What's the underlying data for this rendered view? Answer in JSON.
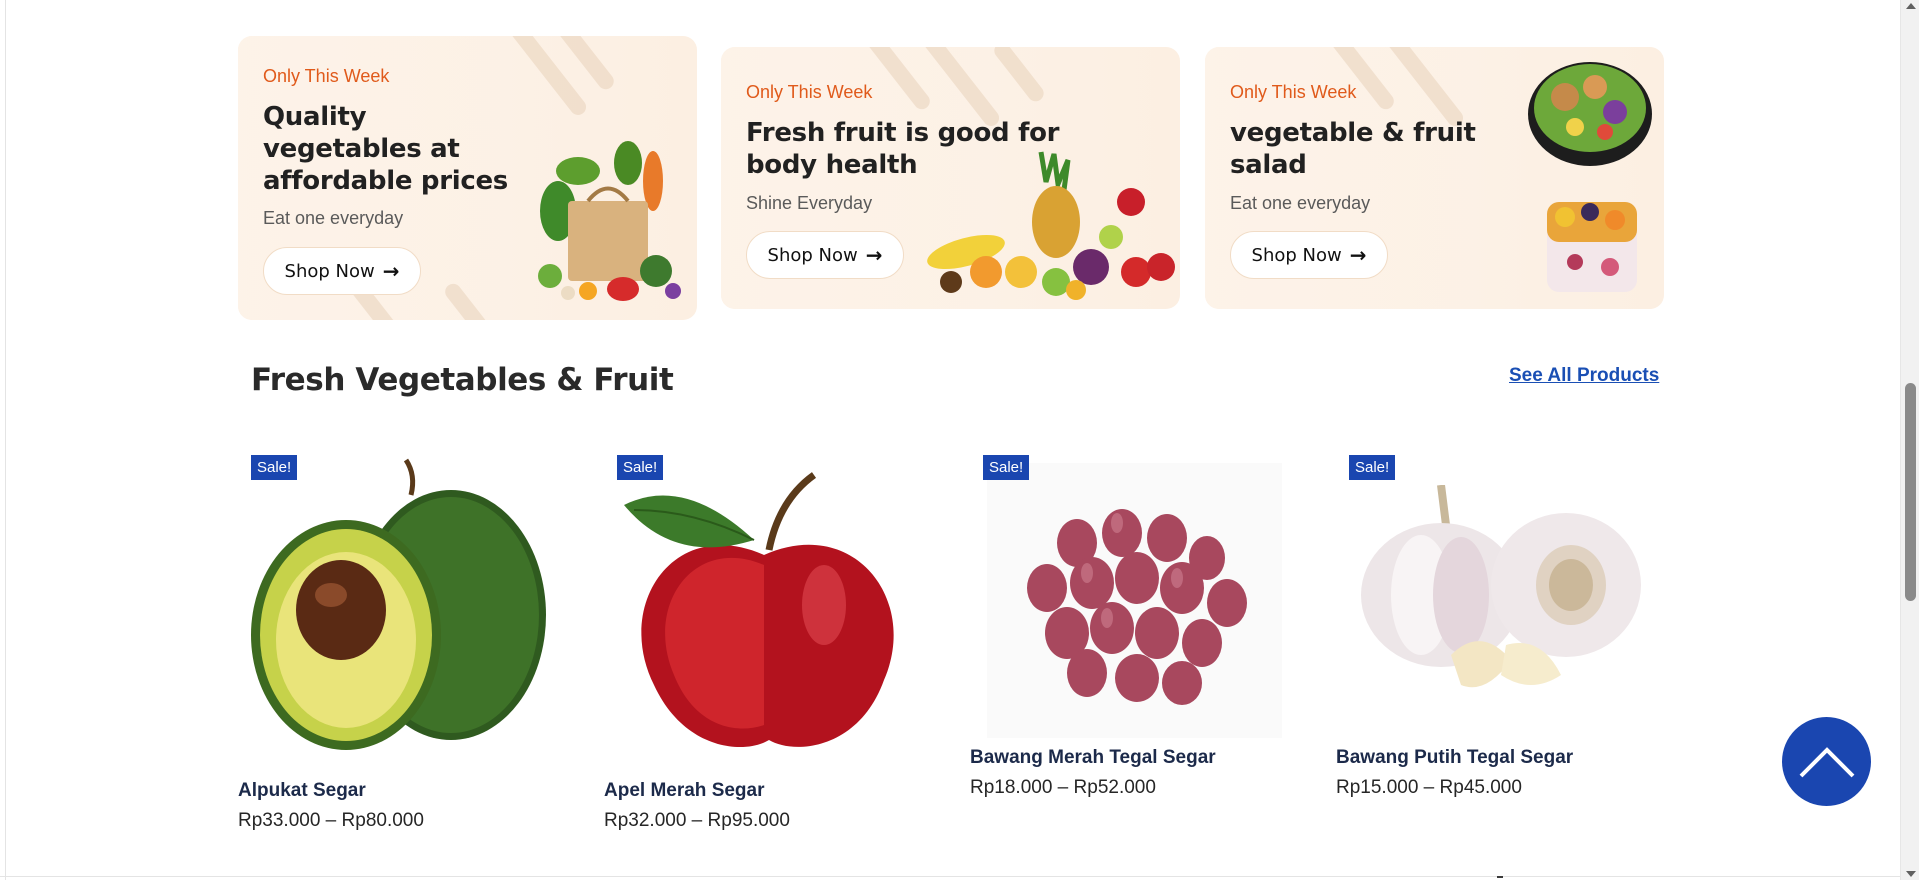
{
  "banners": [
    {
      "eyebrow": "Only This Week",
      "headline_lines": [
        "Quality",
        "vegetables at",
        "affordable prices"
      ],
      "tagline": "Eat one everyday",
      "button_label": "Shop Now",
      "image_icon": "grocery-bag-icon"
    },
    {
      "eyebrow": "Only This Week",
      "headline_lines": [
        "Fresh fruit is good for",
        "body health"
      ],
      "tagline": "Shine Everyday",
      "button_label": "Shop Now",
      "image_icon": "mixed-fruit-icon"
    },
    {
      "eyebrow": "Only This Week",
      "headline_lines": [
        "vegetable & fruit",
        "salad"
      ],
      "tagline": "Eat one everyday",
      "button_label": "Shop Now",
      "image_icon": "salad-bowl-icon"
    }
  ],
  "section": {
    "title": "Fresh Vegetables & Fruit",
    "see_all_label": "See All Products"
  },
  "products": [
    {
      "badge": "Sale!",
      "name": "Alpukat Segar",
      "price": "Rp33.000 – Rp80.000",
      "image_icon": "avocado-icon"
    },
    {
      "badge": "Sale!",
      "name": "Apel Merah Segar",
      "price": "Rp32.000 – Rp95.000",
      "image_icon": "red-apple-icon"
    },
    {
      "badge": "Sale!",
      "name": "Bawang Merah Tegal Segar",
      "price": "Rp18.000 – Rp52.000",
      "image_icon": "shallot-icon"
    },
    {
      "badge": "Sale!",
      "name": "Bawang Putih Tegal Segar",
      "price": "Rp15.000 – Rp45.000",
      "image_icon": "garlic-icon"
    }
  ],
  "icons": {
    "button_arrow": "→",
    "back_to_top": "chevron-up-icon"
  },
  "colors": {
    "accent_blue": "#1a46b0",
    "eyebrow_orange": "#e05a1b",
    "banner_bg": "#fcefe2"
  }
}
